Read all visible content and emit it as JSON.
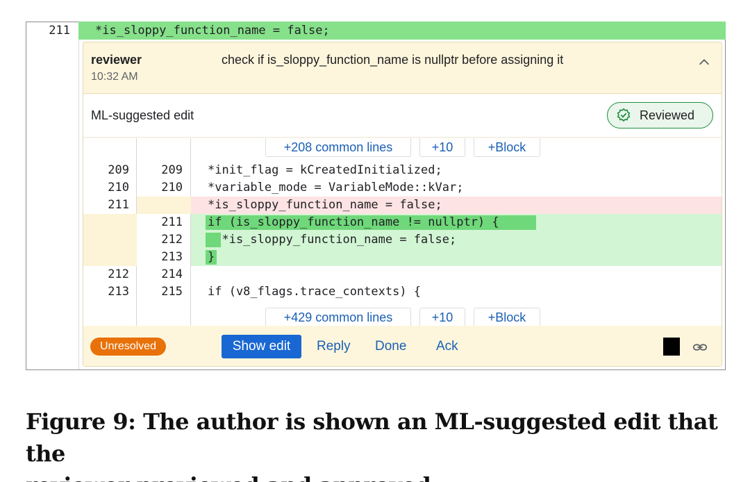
{
  "main_line": {
    "number": "211",
    "code": "*is_sloppy_function_name = false;"
  },
  "comment": {
    "author": "reviewer",
    "time": "10:32 AM",
    "text": "check if is_sloppy_function_name is nullptr before assigning it",
    "collapse_icon": "chevron-up-icon"
  },
  "ml_edit": {
    "title": "ML-suggested edit",
    "status_label": "Reviewed",
    "status_icon": "check-badge-icon",
    "status_color": "#1e8e3e"
  },
  "diff": {
    "top_expanders": [
      "+208 common lines",
      "+10",
      "+Block"
    ],
    "bottom_expanders": [
      "+429 common lines",
      "+10",
      "+Block"
    ],
    "rows": [
      {
        "old": "209",
        "new": "209",
        "code": "*init_flag = kCreatedInitialized;",
        "kind": "context"
      },
      {
        "old": "210",
        "new": "210",
        "code": "*variable_mode = VariableMode::kVar;",
        "kind": "context"
      },
      {
        "old": "211",
        "new": "",
        "code": "*is_sloppy_function_name = false;",
        "kind": "removed"
      },
      {
        "old": "",
        "new": "211",
        "code": "if (is_sloppy_function_name != nullptr) {",
        "kind": "added"
      },
      {
        "old": "",
        "new": "212",
        "code": "  *is_sloppy_function_name = false;",
        "kind": "added"
      },
      {
        "old": "",
        "new": "213",
        "code": "}",
        "kind": "added"
      },
      {
        "old": "212",
        "new": "214",
        "code": "",
        "kind": "context"
      },
      {
        "old": "213",
        "new": "215",
        "code": "if (v8_flags.trace_contexts) {",
        "kind": "context"
      }
    ]
  },
  "footer": {
    "status_badge": "Unresolved",
    "show_edit": "Show edit",
    "reply": "Reply",
    "done": "Done",
    "ack": "Ack",
    "link_icon": "link-icon"
  },
  "caption": {
    "line1": "Figure 9: The author is shown an ML-suggested edit that the",
    "line2": "reviewer previewed and approved."
  },
  "colors": {
    "added_bg": "#d2f5d4",
    "added_strong": "#6fd87a",
    "removed_bg": "#fde3e3",
    "card_bg": "#fdf6dc",
    "badge_orange": "#e8710a",
    "primary_blue": "#1967d2"
  }
}
